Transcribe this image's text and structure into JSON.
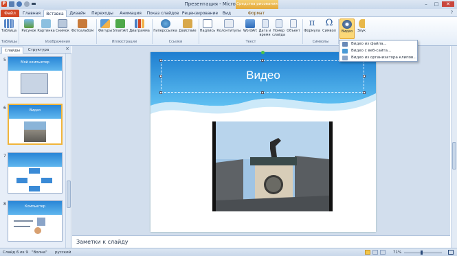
{
  "titlebar": {
    "title": "Презентация - Microsoft PowerPoint",
    "context_tab": "Средства рисования",
    "app_letter": "P",
    "minimize": "–",
    "maximize": "□",
    "close": "✕"
  },
  "tabs": {
    "file": "Файл",
    "home": "Главная",
    "insert": "Вставка",
    "design": "Дизайн",
    "transitions": "Переходы",
    "animations": "Анимация",
    "slideshow": "Показ слайдов",
    "review": "Рецензирование",
    "view": "Вид",
    "format": "Формат"
  },
  "ribbon": {
    "table": "Таблица",
    "picture": "Рисунок",
    "clipart": "Картинка",
    "snapshot": "Снимок",
    "photoalbum": "Фотоальбом",
    "shapes": "Фигуры",
    "smartart": "SmartArt",
    "chart": "Диаграмма",
    "hyperlink": "Гиперссылка",
    "action": "Действие",
    "textbox": "Надпись",
    "headerfooter": "Колонтитулы",
    "wordart": "WordArt",
    "datetime1": "Дата и",
    "datetime2": "время",
    "slidenum1": "Номер",
    "slidenum2": "слайда",
    "object": "Объект",
    "equation": "Формула",
    "symbol": "Символ",
    "video": "Видео",
    "audio": "Звук",
    "groups": {
      "tables": "Таблицы",
      "images": "Изображения",
      "illustrations": "Иллюстрации",
      "links": "Ссылки",
      "text": "Текст",
      "symbols": "Символы"
    }
  },
  "dropdown": {
    "from_file": "Видео из файла...",
    "from_site": "Видео с веб-сайта...",
    "from_clipart": "Видео из организатора клипов..."
  },
  "panel": {
    "tab_slides": "Слайды",
    "tab_outline": "Структура",
    "close": "×",
    "thumbs": [
      {
        "num": "5",
        "title": "Мой компьютер"
      },
      {
        "num": "6",
        "title": "Видео"
      },
      {
        "num": "7",
        "title": ""
      },
      {
        "num": "8",
        "title": "Компьютер"
      }
    ]
  },
  "slide": {
    "title": "Видео"
  },
  "notes": {
    "placeholder": "Заметки к слайду"
  },
  "status": {
    "slide_info": "Слайд 6 из 9",
    "theme": "\"Волна\"",
    "language": "русский",
    "zoom": "71%"
  },
  "colors": {
    "accent": "#d24726",
    "ribbon_bg": "#e4edf8",
    "slide_blue": "#2a86d6",
    "selected": "#fbd878"
  }
}
